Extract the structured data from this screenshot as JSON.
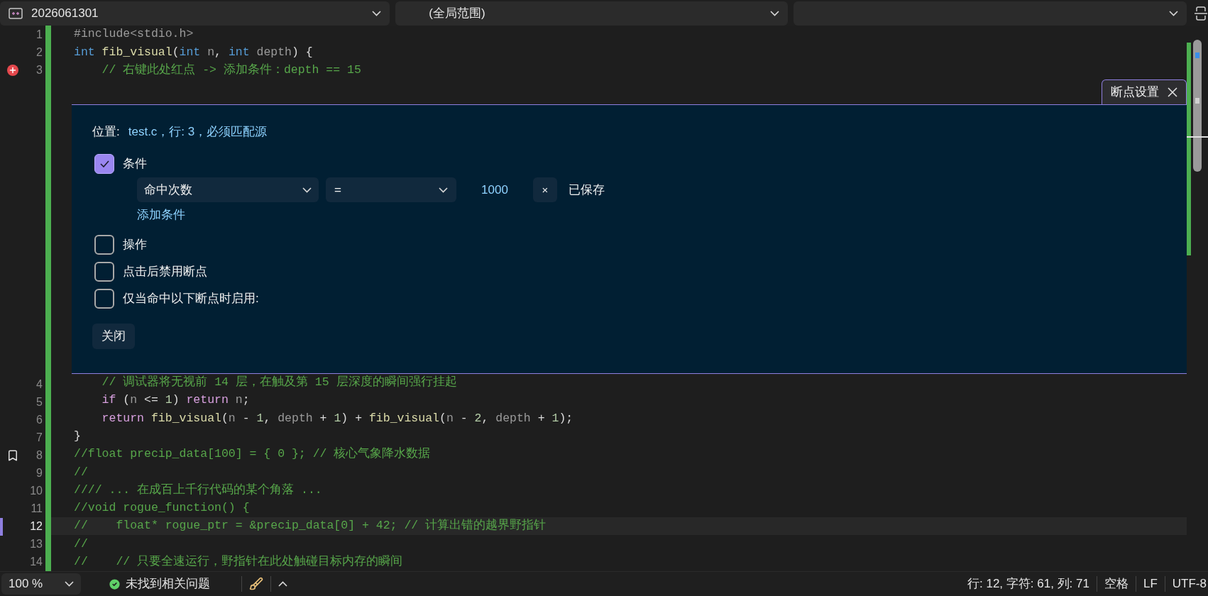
{
  "toolbar": {
    "dropdowns": [
      {
        "kind": "project",
        "label": "2026061301"
      },
      {
        "kind": "scope",
        "label": "(全局范围)"
      },
      {
        "kind": "member"
      }
    ]
  },
  "editor": {
    "lines_before": [
      {
        "number": "1",
        "selected": false,
        "kind": "plain",
        "tokens": [
          {
            "kind": "preproc",
            "text": "#include<stdio.h>"
          }
        ]
      },
      {
        "number": "2",
        "selected": false,
        "kind": "plain",
        "tokens": [
          {
            "kind": "keyword",
            "text": "int"
          },
          {
            "kind": "function",
            "text": " fib_visual"
          },
          {
            "kind": "plain",
            "text": "("
          },
          {
            "kind": "keyword",
            "text": "int"
          },
          {
            "kind": "param",
            "text": " n"
          },
          {
            "kind": "plain",
            "text": ", "
          },
          {
            "kind": "keyword",
            "text": "int"
          },
          {
            "kind": "param",
            "text": " depth"
          },
          {
            "kind": "plain",
            "text": ") {"
          }
        ]
      },
      {
        "number": "3",
        "selected": false,
        "kind": "breakpoint",
        "tokens": [
          {
            "kind": "comment",
            "text": "    // 右键此处红点 -> 添加条件：depth == 15"
          }
        ]
      }
    ],
    "lines_after": [
      {
        "number": "4",
        "selected": false,
        "kind": "plain",
        "tokens": [
          {
            "kind": "comment",
            "text": "    // 调试器将无视前 14 层，在触及第 15 层深度的瞬间强行挂起"
          }
        ]
      },
      {
        "number": "5",
        "selected": false,
        "kind": "plain",
        "tokens": [
          {
            "kind": "control",
            "text": "    if"
          },
          {
            "kind": "plain",
            "text": " ("
          },
          {
            "kind": "param",
            "text": "n"
          },
          {
            "kind": "plain",
            "text": " <= "
          },
          {
            "kind": "number",
            "text": "1"
          },
          {
            "kind": "plain",
            "text": ") "
          },
          {
            "kind": "control",
            "text": "return"
          },
          {
            "kind": "param",
            "text": " n"
          },
          {
            "kind": "plain",
            "text": ";"
          }
        ]
      },
      {
        "number": "6",
        "selected": false,
        "kind": "plain",
        "tokens": [
          {
            "kind": "control",
            "text": "    return"
          },
          {
            "kind": "function",
            "text": " fib_visual"
          },
          {
            "kind": "plain",
            "text": "("
          },
          {
            "kind": "param",
            "text": "n"
          },
          {
            "kind": "plain",
            "text": " - "
          },
          {
            "kind": "number",
            "text": "1"
          },
          {
            "kind": "plain",
            "text": ", "
          },
          {
            "kind": "param",
            "text": "depth"
          },
          {
            "kind": "plain",
            "text": " + "
          },
          {
            "kind": "number",
            "text": "1"
          },
          {
            "kind": "plain",
            "text": ") + "
          },
          {
            "kind": "function",
            "text": "fib_visual"
          },
          {
            "kind": "plain",
            "text": "("
          },
          {
            "kind": "param",
            "text": "n"
          },
          {
            "kind": "plain",
            "text": " - "
          },
          {
            "kind": "number",
            "text": "2"
          },
          {
            "kind": "plain",
            "text": ", "
          },
          {
            "kind": "param",
            "text": "depth"
          },
          {
            "kind": "plain",
            "text": " + "
          },
          {
            "kind": "number",
            "text": "1"
          },
          {
            "kind": "plain",
            "text": ");"
          }
        ]
      },
      {
        "number": "7",
        "selected": false,
        "kind": "plain",
        "tokens": [
          {
            "kind": "plain",
            "text": "}"
          }
        ]
      },
      {
        "number": "8",
        "selected": false,
        "kind": "bookmark",
        "tokens": [
          {
            "kind": "comment",
            "text": "//float precip_data[100] = { 0 }; // 核心气象降水数据"
          }
        ]
      },
      {
        "number": "9",
        "selected": false,
        "kind": "plain",
        "tokens": [
          {
            "kind": "comment",
            "text": "//"
          }
        ]
      },
      {
        "number": "10",
        "selected": false,
        "kind": "plain",
        "tokens": [
          {
            "kind": "comment",
            "text": "//// ... 在成百上千行代码的某个角落 ..."
          }
        ]
      },
      {
        "number": "11",
        "selected": false,
        "kind": "plain",
        "tokens": [
          {
            "kind": "comment",
            "text": "//void rogue_function() {"
          }
        ]
      },
      {
        "number": "12",
        "selected": true,
        "kind": "plain",
        "tokens": [
          {
            "kind": "comment",
            "text": "//    float* rogue_ptr = &precip_data[0] + 42; // 计算出错的越界野指针"
          }
        ]
      },
      {
        "number": "13",
        "selected": false,
        "kind": "plain",
        "tokens": [
          {
            "kind": "comment",
            "text": "//"
          }
        ]
      },
      {
        "number": "14",
        "selected": false,
        "kind": "plain",
        "tokens": [
          {
            "kind": "comment",
            "text": "//    // 只要全速运行，野指针在此处触碰目标内存的瞬间"
          }
        ]
      }
    ]
  },
  "breakpoint_settings": {
    "tab": "断点设置",
    "location_label": "位置:",
    "location": "test.c，行: 3，必须匹配源",
    "options": [
      {
        "kind": "condition",
        "label": "条件",
        "checked": true,
        "condition": {
          "type": "命中次数",
          "operator": "=",
          "value": "1000",
          "clear": "×",
          "status": "已保存"
        },
        "add_link": "添加条件"
      },
      {
        "kind": "plain",
        "label": "操作",
        "checked": false
      },
      {
        "kind": "plain",
        "label": "点击后禁用断点",
        "checked": false
      },
      {
        "kind": "plain",
        "label": "仅当命中以下断点时启用:",
        "checked": false
      }
    ],
    "close_button": "关闭"
  },
  "status_bar": {
    "zoom": "100 %",
    "issues": "未找到相关问题",
    "position": "行: 12, 字符: 61, 列: 71",
    "indent": "空格",
    "line_ending": "LF",
    "encoding": "UTF-8"
  }
}
